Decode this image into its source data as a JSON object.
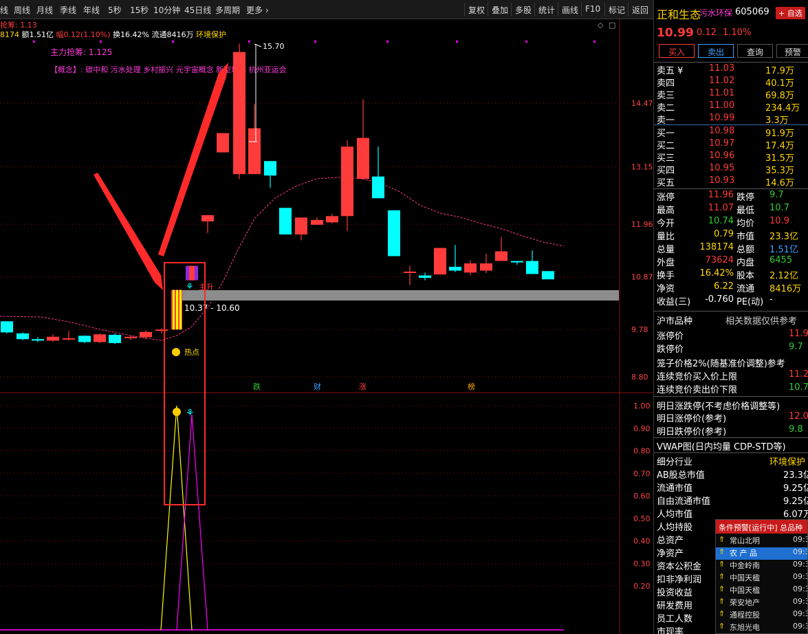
{
  "toolbar": {
    "left_items": [
      "线",
      "周线",
      "月线",
      "季线",
      "年线",
      "5秒",
      "15秒",
      "10分钟",
      "45日线",
      "多周期",
      "更多 ›"
    ],
    "right_items": [
      "复权",
      "叠加",
      "多股",
      "统计",
      "画线",
      "F10",
      "标记",
      "返回"
    ]
  },
  "info": {
    "line1": "抢筹: 1.13",
    "line2_prefix": "8174",
    "line2_amount": "额1.51亿",
    "line2_range": "幅0.12(1.10%)",
    "line2_turnover": "换16.42%",
    "line2_float": "流通8416万",
    "line2_industry": "环境保护",
    "main_label": "主力抢筹: 1.125",
    "concept": "【概念】: 碳中和 污水处理 乡村振兴 元宇宙概念 新型城镇 杭州亚运会"
  },
  "chart_data": {
    "type": "candlestick",
    "y_axis_ticks": [
      "14.47",
      "13.15",
      "11.96",
      "10.87",
      "9.78",
      "8.80"
    ],
    "candles": [
      {
        "o": 9.95,
        "c": 9.72,
        "h": 9.95,
        "l": 9.7
      },
      {
        "o": 9.7,
        "c": 9.58,
        "h": 9.72,
        "l": 9.56
      },
      {
        "o": 9.58,
        "c": 9.55,
        "h": 9.62,
        "l": 9.52
      },
      {
        "o": 9.55,
        "c": 9.63,
        "h": 9.68,
        "l": 9.53
      },
      {
        "o": 9.58,
        "c": 9.6,
        "h": 9.75,
        "l": 9.55
      },
      {
        "o": 9.65,
        "c": 9.52,
        "h": 9.66,
        "l": 9.5
      },
      {
        "o": 9.52,
        "c": 9.68,
        "h": 9.7,
        "l": 9.5
      },
      {
        "o": 9.67,
        "c": 9.5,
        "h": 9.7,
        "l": 9.48
      },
      {
        "o": 9.6,
        "c": 9.63,
        "h": 9.66,
        "l": 9.56
      },
      {
        "o": 9.62,
        "c": 9.73,
        "h": 9.76,
        "l": 9.58
      },
      {
        "o": 9.78,
        "c": 9.78,
        "h": 9.8,
        "l": 9.7
      },
      {
        "o": 9.78,
        "c": 10.6,
        "h": 10.6,
        "l": 9.78
      },
      {
        "o": 10.8,
        "c": 11.1,
        "h": 11.1,
        "l": 10.8
      },
      {
        "o": 12.02,
        "c": 12.15,
        "h": 12.15,
        "l": 11.78
      },
      {
        "o": 13.45,
        "c": 13.85,
        "h": 13.85,
        "l": 13.45
      },
      {
        "o": 13.0,
        "c": 15.53,
        "h": 15.7,
        "l": 12.9
      },
      {
        "o": 13.0,
        "c": 13.95,
        "h": 14.45,
        "l": 13.0
      },
      {
        "o": 13.27,
        "c": 12.97,
        "h": 13.27,
        "l": 12.72
      },
      {
        "o": 12.3,
        "c": 11.75,
        "h": 12.3,
        "l": 11.75
      },
      {
        "o": 11.75,
        "c": 12.1,
        "h": 12.1,
        "l": 11.63
      },
      {
        "o": 11.95,
        "c": 12.05,
        "h": 12.1,
        "l": 11.95
      },
      {
        "o": 12.0,
        "c": 12.13,
        "h": 12.18,
        "l": 11.98
      },
      {
        "o": 12.13,
        "c": 13.57,
        "h": 13.7,
        "l": 11.82
      },
      {
        "o": 12.9,
        "c": 13.75,
        "h": 14.55,
        "l": 12.9
      },
      {
        "o": 12.95,
        "c": 12.5,
        "h": 13.57,
        "l": 12.5
      },
      {
        "o": 12.25,
        "c": 11.3,
        "h": 12.25,
        "l": 11.3
      },
      {
        "o": 10.96,
        "c": 10.98,
        "h": 11.1,
        "l": 10.7
      },
      {
        "o": 10.9,
        "c": 10.85,
        "h": 10.96,
        "l": 10.8
      },
      {
        "o": 10.92,
        "c": 11.47,
        "h": 11.47,
        "l": 10.92
      },
      {
        "o": 11.08,
        "c": 11.0,
        "h": 11.53,
        "l": 10.97
      },
      {
        "o": 10.96,
        "c": 11.15,
        "h": 11.22,
        "l": 10.9
      },
      {
        "o": 11.0,
        "c": 11.15,
        "h": 11.35,
        "l": 10.95
      },
      {
        "o": 11.2,
        "c": 11.4,
        "h": 11.7,
        "l": 11.2
      },
      {
        "o": 11.2,
        "c": 11.17,
        "h": 11.2,
        "l": 11.12
      },
      {
        "o": 11.2,
        "c": 10.93,
        "h": 11.42,
        "l": 10.93
      },
      {
        "o": 10.99,
        "c": 10.82,
        "h": 10.99,
        "l": 10.82
      }
    ],
    "annotations": {
      "peak": "15.70",
      "range": "10.37 - 10.60",
      "rise": "主升",
      "hot": "热点",
      "day_marks": [
        "跌",
        "财",
        "涨",
        "榜"
      ]
    },
    "indicator": {
      "y_ticks": [
        "1.00",
        "0.90",
        "0.80",
        "0.70",
        "0.60",
        "0.50",
        "0.40",
        "0.30",
        "0.20"
      ],
      "yellow_peak": 1.0,
      "magenta_peak": 0.96
    }
  },
  "quote": {
    "name": "正和生态",
    "tag": "污水环保",
    "code": "605069",
    "add_fav": "+ 自选",
    "price": "10.99",
    "change": "0.12",
    "pct": "1.10%",
    "buttons": [
      "买入",
      "卖出",
      "查询",
      "预警"
    ],
    "asks": [
      {
        "label": "卖五 ¥",
        "price": "11.03",
        "vol": "17.9万"
      },
      {
        "label": "卖四",
        "price": "11.02",
        "vol": "40.1万"
      },
      {
        "label": "卖三",
        "price": "11.01",
        "vol": "69.8万"
      },
      {
        "label": "卖二",
        "price": "11.00",
        "vol": "234.4万"
      },
      {
        "label": "卖一",
        "price": "10.99",
        "vol": "3.3万"
      }
    ],
    "bids": [
      {
        "label": "买一",
        "price": "10.98",
        "vol": "91.9万"
      },
      {
        "label": "买二",
        "price": "10.97",
        "vol": "17.4万"
      },
      {
        "label": "买三",
        "price": "10.96",
        "vol": "31.5万"
      },
      {
        "label": "买四",
        "price": "10.95",
        "vol": "35.3万"
      },
      {
        "label": "买五",
        "price": "10.93",
        "vol": "14.6万"
      }
    ],
    "stats": [
      {
        "l1": "涨停",
        "v1": "11.96",
        "l2": "跌停",
        "v2": "9.7"
      },
      {
        "l1": "最高",
        "v1": "11.07",
        "l2": "最低",
        "v2": "10.7"
      },
      {
        "l1": "今开",
        "v1": "10.74",
        "l2": "均价",
        "v2": "10.9"
      },
      {
        "l1": "量比",
        "v1": "0.79",
        "l2": "市值",
        "v2": "23.3亿"
      },
      {
        "l1": "总量",
        "v1": "138174",
        "l2": "总额",
        "v2": "1.51亿"
      },
      {
        "l1": "外盘",
        "v1": "73624",
        "l2": "内盘",
        "v2": "6455"
      },
      {
        "l1": "换手",
        "v1": "16.42%",
        "l2": "股本",
        "v2": "2.12亿"
      },
      {
        "l1": "净资",
        "v1": "6.22",
        "l2": "流通",
        "v2": "8416万"
      },
      {
        "l1": "收益(三)",
        "v1": "-0.760",
        "l2": "PE(动)",
        "v2": "-"
      }
    ],
    "limits_header": {
      "title": "沪市品种",
      "note": "相关数据仅供参考"
    },
    "limits": [
      {
        "label": "涨停价",
        "value": "11.9"
      },
      {
        "label": "跌停价",
        "value": "9.7"
      }
    ],
    "cage_label": "笼子价格2%(随基准价调整)参考",
    "auction": [
      {
        "label": "连续竞价买入价上限",
        "value": "11.2"
      },
      {
        "label": "连续竞价卖出价下限",
        "value": "10.7"
      }
    ],
    "tomorrow_label": "明日涨跌停(不考虑价格调整等)",
    "tomorrow": [
      {
        "label": "明日涨停价(参考)",
        "value": "12.0"
      },
      {
        "label": "明日跌停价(参考)",
        "value": "9.8"
      }
    ],
    "vwap_label": "VWAP图(日内均量 CDP-STD等)",
    "fundamentals": [
      {
        "label": "细分行业",
        "value": "环境保护"
      },
      {
        "label": "AB股总市值",
        "value": "23.3亿"
      },
      {
        "label": "流通市值",
        "value": "9.25亿"
      },
      {
        "label": "自由流通市值",
        "value": "9.25亿"
      },
      {
        "label": "人均市值",
        "value": "6.07万"
      },
      {
        "label": "人均持股",
        "value": ""
      },
      {
        "label": "总资产",
        "value": ""
      },
      {
        "label": "净资产",
        "value": ""
      },
      {
        "label": "资本公积金",
        "value": ""
      },
      {
        "label": "扣非净利润",
        "value": ""
      },
      {
        "label": "投资收益",
        "value": ""
      },
      {
        "label": "研发费用",
        "value": ""
      },
      {
        "label": "员工人数",
        "value": ""
      },
      {
        "label": "市现率",
        "value": ""
      }
    ]
  },
  "alert": {
    "title": "条件预警[运行中] 总品种",
    "rows": [
      {
        "name": "常山北明",
        "time": "09:3"
      },
      {
        "name": "农 产 品",
        "time": "09:3"
      },
      {
        "name": "中金岭南",
        "time": "09:3"
      },
      {
        "name": "中国天楹",
        "time": "09:3"
      },
      {
        "name": "中国天楹",
        "time": "09:3"
      },
      {
        "name": "荣安地产",
        "time": "09:3"
      },
      {
        "name": "通程控股",
        "time": "09:3"
      },
      {
        "name": "东旭光电",
        "time": "09:3"
      }
    ]
  },
  "colors": {
    "up": "#ff3b3b",
    "down": "#00ffff",
    "ma": "#ff3b8f",
    "yellow": "#ffff00",
    "magenta": "#ff00ff",
    "gridline": "#8a1010"
  }
}
